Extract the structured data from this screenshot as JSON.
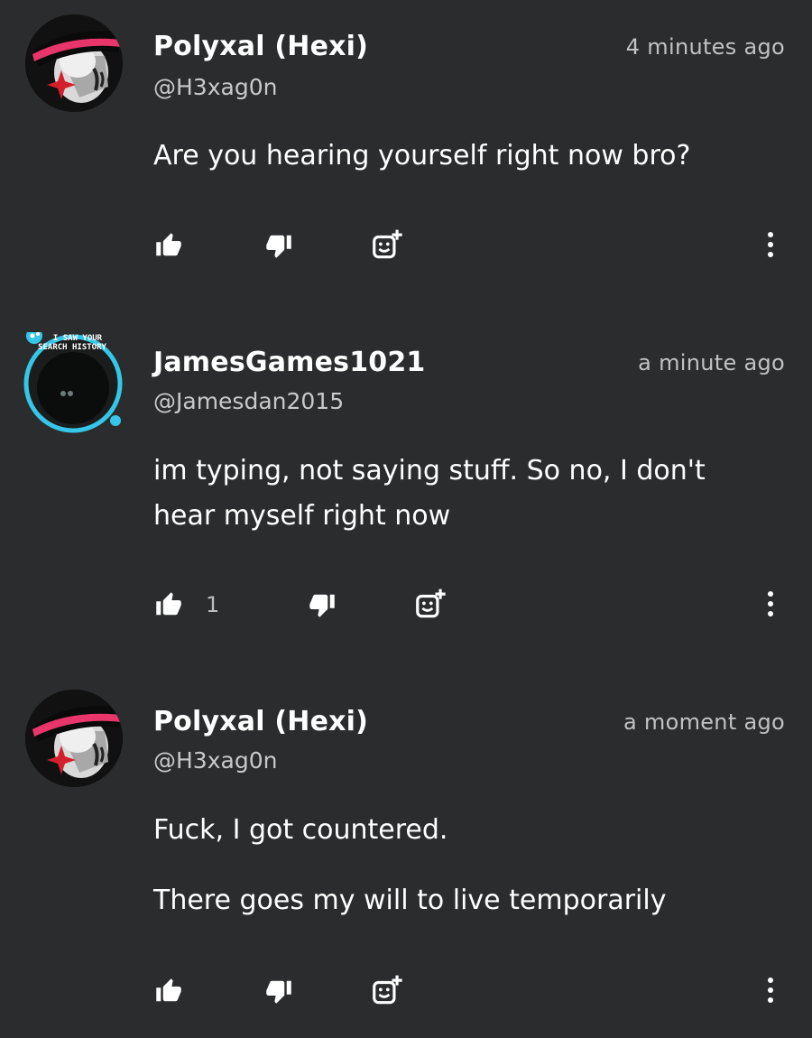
{
  "comments": [
    {
      "display_name": "Polyxal (Hexi)",
      "handle": "@H3xag0n",
      "timestamp": "4 minutes ago",
      "lines": [
        "Are you hearing yourself right now bro?"
      ],
      "like_count": "",
      "avatar_icon": "hat-mask-avatar-icon"
    },
    {
      "display_name": "JamesGames1021",
      "handle": "@Jamesdan2015",
      "timestamp": "a minute ago",
      "lines": [
        "im typing, not saying stuff. So no, I don't",
        "hear myself right now"
      ],
      "like_count": "1",
      "avatar_icon": "search-history-avatar-icon",
      "avatar_banner": [
        "I SAW YOUR",
        "SEARCH HISTORY"
      ]
    },
    {
      "display_name": "Polyxal (Hexi)",
      "handle": "@H3xag0n",
      "timestamp": "a moment ago",
      "paragraphs": [
        "Fuck, I got countered.",
        "There goes my will to live temporarily"
      ],
      "like_count": "",
      "avatar_icon": "hat-mask-avatar-icon"
    }
  ],
  "icons": {
    "like": "thumbs-up-icon",
    "dislike": "thumbs-down-icon",
    "react": "add-reaction-icon",
    "more": "more-vertical-icon"
  },
  "colors": {
    "background": "#2b2c2d",
    "text": "#ffffff",
    "muted": "#c2c2c2",
    "avatar_ring": "#36c6e8",
    "hat_band": "#e8356b",
    "cross": "#d4202c"
  }
}
